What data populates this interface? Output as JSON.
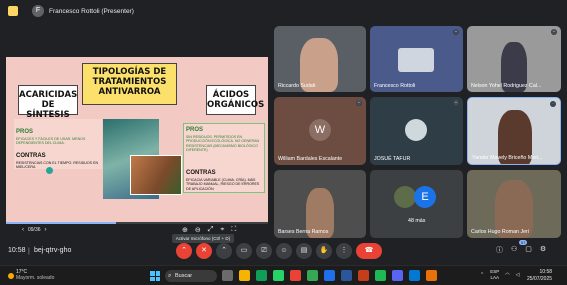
{
  "topbar": {
    "avatar_letter": "F",
    "presenter": "Francesco Rottoli (Presenter)"
  },
  "slide": {
    "title": "TIPOLOGÍAS DE TRATAMIENTOS ANTIVARROA",
    "left_heading": "ACARICIDAS DE SÍNTESIS",
    "right_heading": "ÁCIDOS ORGÁNICOS",
    "left_pros_label": "PROS",
    "left_pros_text": "EFICACES Y FÁCILES DE USAR. MENOS DEPENDIENTES DEL CLIMA.",
    "left_contras_label": "CONTRAS",
    "left_contras_text": "RESISTENCIAS CON EL TIEMPO. RESIDUOS EN MIEL/CERA",
    "right_pros_label": "PROS",
    "right_pros_text": "SIN RESIDUOS. PERMITIDOS EN PRODUCCIÓN ECOLÓGICA. NO GENERAN RESISTENCIAS (MECANISMO BIOLÓGICO DIFERENTE)",
    "right_contras_label": "CONTRAS",
    "right_contras_text": "EFICACIA VARIABLE (CLIMA, CRÍA). MÁS TRABAJO MANUAL, RIESGO DE ERRORES DE APLICACIÓN",
    "progress": 0.42
  },
  "pager": {
    "prev": "‹",
    "label": "09/36",
    "next": "›"
  },
  "tooltip": "Activar micrófono (Ctrl + D)",
  "participants": [
    {
      "name": "Riccardo Sudati",
      "avatar": ""
    },
    {
      "name": "Francesco Rottoli",
      "avatar": ""
    },
    {
      "name": "Nelson Yohel Rodriguez Cal...",
      "avatar": ""
    },
    {
      "name": "William Bardales Escalante",
      "avatar": "W"
    },
    {
      "name": "JOSUÉ TAFUR",
      "avatar": ""
    },
    {
      "name": "Yander Mavely Briceño Men...",
      "avatar": ""
    },
    {
      "name": "Barses Berna Ramos",
      "avatar": ""
    },
    {
      "name": "48 más",
      "avatar": "E"
    },
    {
      "name": "Carlos Hugo Roman Jeri",
      "avatar": ""
    }
  ],
  "callbar": {
    "time": "10:58",
    "separator": "|",
    "code": "bej-qtrv-gho",
    "people_count": "57"
  },
  "taskbar": {
    "temp": "17°C",
    "weather": "Mayorm. soleado",
    "search": "Buscar",
    "lang_top": "ESP",
    "lang_bottom": "LAA",
    "clock": "10:58",
    "date": "25/07/2025"
  },
  "colors": {
    "end_call": "#ea4335",
    "accent": "#8ab4f8",
    "slide_bg": "#f3c9c4",
    "title_box": "#fbe06b"
  }
}
